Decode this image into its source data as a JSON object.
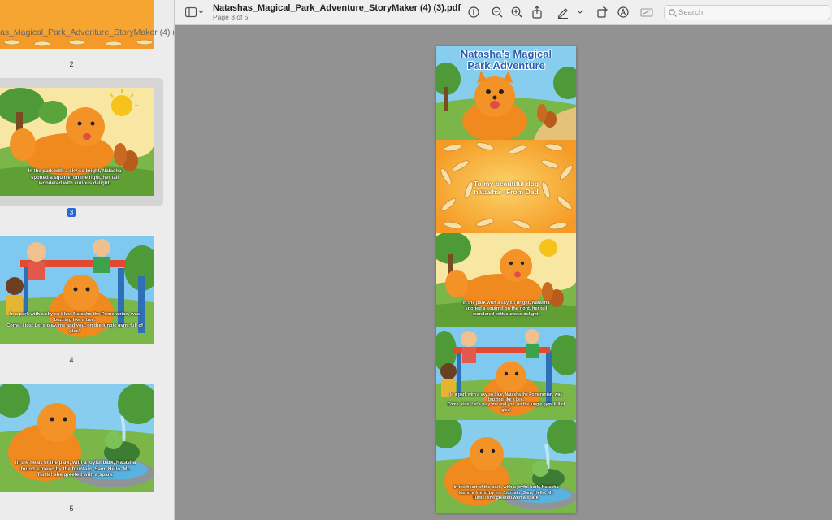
{
  "window": {
    "title": "Natashas_Magical_Park_Adventure_StoryMaker (4) (3).pdf",
    "subtitle": "Page 3 of 5"
  },
  "sidebar": {
    "cut_title": "as_Magical_Park_Adventure_StoryMaker (4) (3)...",
    "thumbs": [
      {
        "label": "2"
      },
      {
        "label": "3",
        "selected": true
      },
      {
        "label": "4"
      },
      {
        "label": "5"
      }
    ]
  },
  "search": {
    "placeholder": "Search"
  },
  "book": {
    "cover_title_line1": "Natasha's Magical",
    "cover_title_line2": "Park Adventure",
    "dedication_line1": "To my beautiful dog",
    "dedication_line2": "natasha - From Dad",
    "page3_text_1": "In the park with a sky so bright, Natasha",
    "page3_text_2": "spotted a squirrel on the right, her tail",
    "page3_text_3": "wondered with curious delight.",
    "page4_text_1": "In a park with a sky so blue, Natasha the Pomeranian, was",
    "page4_text_2": "buzzing like a bee.",
    "page4_text_3": "Come, kids! Let's play, me and you, on the jungle gym, full of",
    "page4_text_4": "glee!",
    "page5_text_1": "In the heart of the park, with a joyful bark, Natasha",
    "page5_text_2": "found a friend by the fountain, Sam, Hello, Mr.",
    "page5_text_3": "Turtle! she greeted with a spark."
  },
  "colors": {
    "accent": "#2568d8",
    "pomeranian": "#f08a1e",
    "sky": "#7fc8ef",
    "grass": "#6cb33f"
  }
}
